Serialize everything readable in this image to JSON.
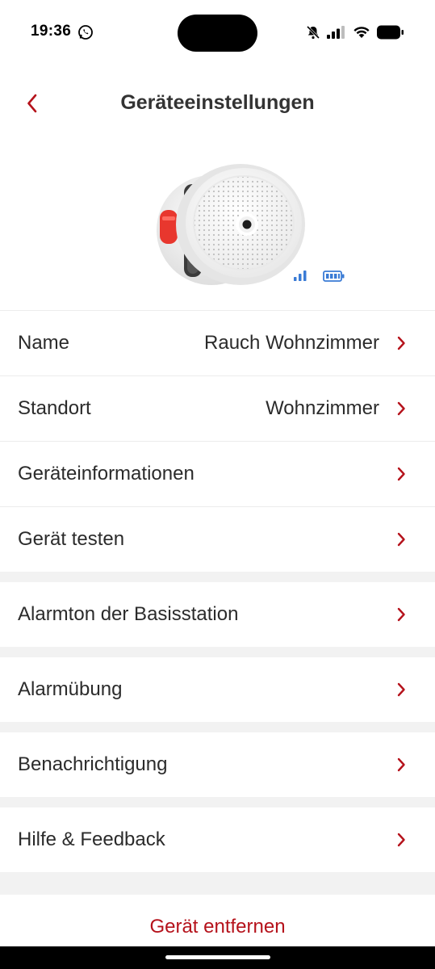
{
  "status_bar": {
    "time": "19:36",
    "icons": [
      "whatsapp-icon",
      "mute-bell-icon",
      "cellular-signal-icon",
      "wifi-icon",
      "battery-icon"
    ]
  },
  "header": {
    "title": "Geräteeinstellungen",
    "back_icon": "chevron-left-icon"
  },
  "device": {
    "image": "smoke-detector",
    "signal_icon": "signal-strength-icon",
    "battery_icon": "battery-full-icon"
  },
  "settings": {
    "name": {
      "label": "Name",
      "value": "Rauch Wohnzimmer"
    },
    "standort": {
      "label": "Standort",
      "value": "Wohnzimmer"
    },
    "info": {
      "label": "Geräteinformationen"
    },
    "test": {
      "label": "Gerät testen"
    },
    "alarmton": {
      "label": "Alarmton der Basisstation"
    },
    "alarmuebung": {
      "label": "Alarmübung"
    },
    "benachrichtigung": {
      "label": "Benachrichtigung"
    },
    "hilfe": {
      "label": "Hilfe & Feedback"
    }
  },
  "remove": {
    "label": "Gerät entfernen"
  },
  "colors": {
    "accent": "#b5121b",
    "icon_blue": "#3a7bd5",
    "separator": "#f2f2f2"
  }
}
